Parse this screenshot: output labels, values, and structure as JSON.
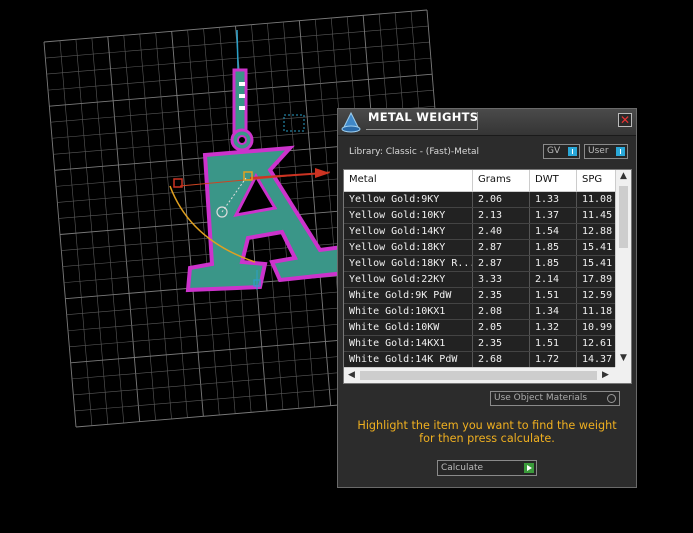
{
  "window": {
    "title": "METAL WEIGHTS",
    "close_label": "✕"
  },
  "library": {
    "label": "Library: Classic - (Fast)-Metal"
  },
  "toggles": {
    "gv": "GV",
    "user": "User"
  },
  "table": {
    "columns": [
      "Metal",
      "Grams",
      "DWT",
      "SPG"
    ],
    "rows": [
      [
        "Yellow Gold:9KY",
        "2.06",
        "1.33",
        "11.08"
      ],
      [
        "Yellow Gold:10KY",
        "2.13",
        "1.37",
        "11.45"
      ],
      [
        "Yellow Gold:14KY",
        "2.40",
        "1.54",
        "12.88"
      ],
      [
        "Yellow Gold:18KY",
        "2.87",
        "1.85",
        "15.41"
      ],
      [
        "Yellow Gold:18KY R...",
        "2.87",
        "1.85",
        "15.41"
      ],
      [
        "Yellow Gold:22KY",
        "3.33",
        "2.14",
        "17.89"
      ],
      [
        "White Gold:9K PdW",
        "2.35",
        "1.51",
        "12.59"
      ],
      [
        "White Gold:10KX1",
        "2.08",
        "1.34",
        "11.18"
      ],
      [
        "White Gold:10KW",
        "2.05",
        "1.32",
        "10.99"
      ],
      [
        "White Gold:14KX1",
        "2.35",
        "1.51",
        "12.61"
      ],
      [
        "White Gold:14K PdW",
        "2.68",
        "1.72",
        "14.37"
      ]
    ]
  },
  "options": {
    "use_object_materials": "Use Object Materials"
  },
  "hint": {
    "line1": "Highlight the item you want to find the weight",
    "line2": "for then press calculate."
  },
  "actions": {
    "calculate": "Calculate"
  },
  "viewport": {
    "object_color": "#3a9688",
    "outline_color": "#cc33cc",
    "gizmo_color": "#2aa0c8"
  }
}
